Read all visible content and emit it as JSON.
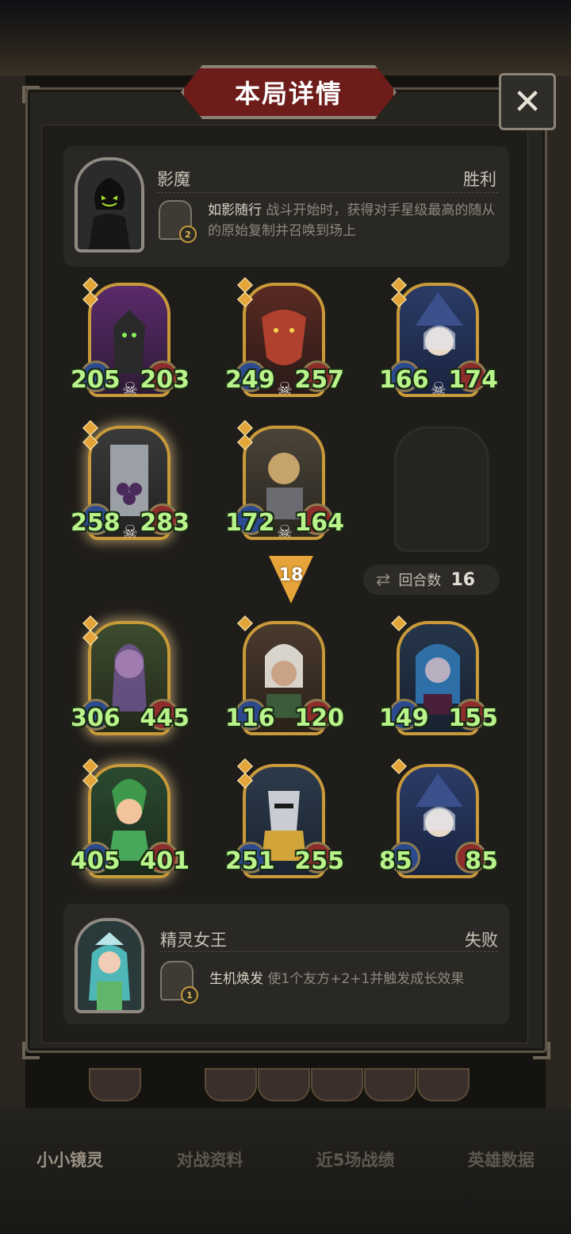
{
  "title": "本局详情",
  "close_label": "✕",
  "top_hero": {
    "name": "影魔",
    "result": "胜利",
    "skill_name": "如影随行",
    "skill_desc": "战斗开始时，获得对手星级最高的随从的原始复制并召唤到场上",
    "skill_level": "2"
  },
  "bottom_hero": {
    "name": "精灵女王",
    "result": "失败",
    "skill_name": "生机焕发",
    "skill_desc": "使1个友方+2+1并触发成长效果",
    "skill_level": "1"
  },
  "top_board": [
    {
      "atk": "205",
      "hp": "203"
    },
    {
      "atk": "249",
      "hp": "257"
    },
    {
      "atk": "166",
      "hp": "174"
    },
    {
      "atk": "258",
      "hp": "283"
    },
    {
      "atk": "172",
      "hp": "164"
    }
  ],
  "bottom_board": [
    {
      "atk": "306",
      "hp": "445"
    },
    {
      "atk": "116",
      "hp": "120"
    },
    {
      "atk": "149",
      "hp": "155"
    },
    {
      "atk": "405",
      "hp": "401"
    },
    {
      "atk": "251",
      "hp": "255"
    },
    {
      "atk": "85",
      "hp": "85"
    }
  ],
  "damage": "18",
  "rounds": {
    "label": "回合数",
    "value": "16"
  },
  "bottom_tabs": [
    "小小镜灵",
    "对战资料",
    "近5场战绩",
    "英雄数据"
  ],
  "colors": {
    "stat_green": "#b8f48a",
    "frame_gold": "#c89a3a",
    "title_red": "#6d1c1a"
  }
}
